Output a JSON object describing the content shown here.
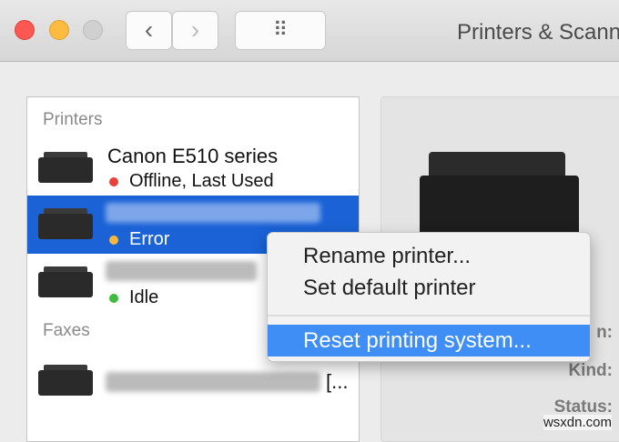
{
  "window": {
    "title": "Printers & Scann"
  },
  "toolbar": {
    "back": "‹",
    "forward": "›",
    "grid": "⠿"
  },
  "sidebar": {
    "printers_header": "Printers",
    "printers": [
      {
        "name": "Canon E510 series",
        "status": "Offline, Last Used",
        "status_color": "#e8413b"
      },
      {
        "name": "",
        "status": "Error",
        "status_color": "#f6b73c",
        "selected": true
      },
      {
        "name": "",
        "status": "Idle",
        "status_color": "#3dbd3d"
      }
    ],
    "faxes_header": "Faxes",
    "faxes": [
      {
        "name_suffix": "[..."
      }
    ]
  },
  "details": {
    "labels": [
      "n:",
      "Kind:",
      "Status:"
    ]
  },
  "context_menu": {
    "items": [
      "Rename printer...",
      "Set default printer",
      "Reset printing system..."
    ],
    "highlighted": 2
  },
  "watermark": "wsxdn.com"
}
